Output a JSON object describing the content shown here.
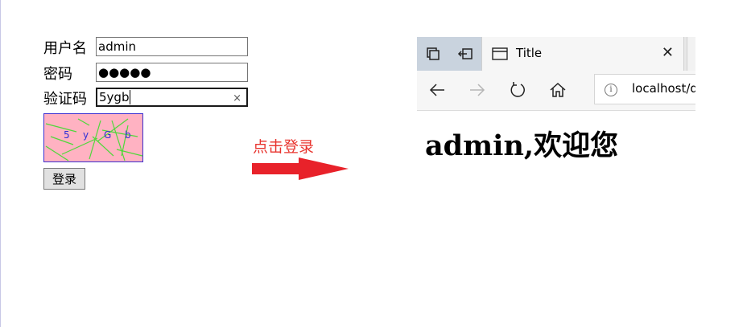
{
  "form": {
    "username_label": "用户名",
    "username_value": "admin",
    "password_label": "密码",
    "password_value": "●●●●●",
    "captcha_label": "验证码",
    "captcha_value": "5ygb",
    "clear_symbol": "×",
    "captcha_chars": [
      "5",
      "y",
      "G",
      "b"
    ],
    "login_button": "登录"
  },
  "annotation": {
    "hint": "点击登录",
    "arrow_color": "#e8222a"
  },
  "browser": {
    "tab_title": "Title",
    "close_symbol": "✕",
    "address": "localhost/d",
    "info_symbol": "i"
  },
  "welcome": "admin,欢迎您"
}
